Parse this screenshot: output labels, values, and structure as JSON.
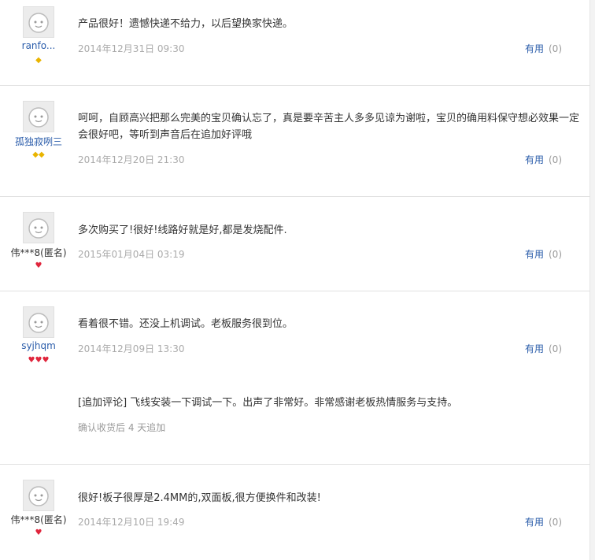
{
  "reviews": [
    {
      "username": "ranfo...",
      "name_style": "link",
      "badge": "◆",
      "badge_color": "yellow",
      "content": "产品很好！遗憾快递不给力，以后望换家快递。",
      "date": "2014年12月31日 09:30",
      "useful_label": "有用",
      "useful_count": "(0)"
    },
    {
      "username": "孤独寂咧三",
      "name_style": "link",
      "badge": "◆◆",
      "badge_color": "yellow",
      "content": "呵呵，自顾高兴把那么完美的宝贝确认忘了，真是要辛苦主人多多见谅为谢啦，宝贝的确用料保守想必效果一定会很好吧，等听到声音后在追加好评哦",
      "date": "2014年12月20日 21:30",
      "useful_label": "有用",
      "useful_count": "(0)"
    },
    {
      "username": "伟***8(匿名)",
      "name_style": "anon",
      "badge": "♥",
      "badge_color": "red",
      "content": "多次购买了!很好!线路好就是好,都是发烧配件.",
      "date": "2015年01月04日 03:19",
      "useful_label": "有用",
      "useful_count": "(0)"
    },
    {
      "username": "syjhqm",
      "name_style": "link",
      "badge": "♥♥♥",
      "badge_color": "red",
      "content": "看着很不错。还没上机调试。老板服务很到位。",
      "date": "2014年12月09日 13:30",
      "useful_label": "有用",
      "useful_count": "(0)",
      "append": {
        "content": "[追加评论] 飞线安装一下调试一下。出声了非常好。非常感谢老板热情服务与支持。",
        "note": "确认收货后 4 天追加"
      }
    },
    {
      "username": "伟***8(匿名)",
      "name_style": "anon",
      "badge": "♥",
      "badge_color": "red",
      "content": "很好!板子很厚是2.4MM的,双面板,很方便换件和改装!",
      "date": "2014年12月10日 19:49",
      "useful_label": "有用",
      "useful_count": "(0)"
    }
  ]
}
